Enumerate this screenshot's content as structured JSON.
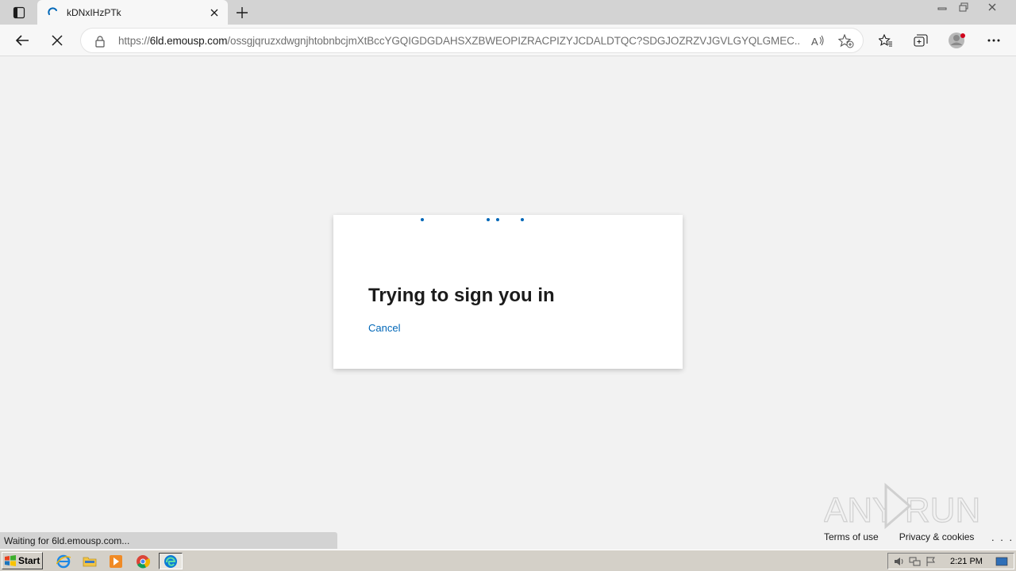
{
  "browser": {
    "tab": {
      "title": "kDNxIHzPTk"
    },
    "address": {
      "prefix": "https://",
      "host": "6ld.emousp.com",
      "path": "/ossgjqruzxdwgnjhtobnbcjmXtBccYGQIGDGDAHSXZBWEOPIZRACPIZYJCDALDTQC?SDGJOZRZVJGVLGYQLGMEC..."
    },
    "status_text": "Waiting for 6ld.emousp.com..."
  },
  "page": {
    "title": "Trying to sign you in",
    "cancel_label": "Cancel",
    "footer": {
      "terms_label": "Terms of use",
      "privacy_label": "Privacy & cookies",
      "more_label": ". . ."
    },
    "accent_color": "#0067b8"
  },
  "watermark": {
    "text": "ANY RUN"
  },
  "taskbar": {
    "start_label": "Start",
    "clock": "2:21 PM",
    "apps": [
      "internet-explorer-icon",
      "folder-icon",
      "media-player-icon",
      "chrome-icon",
      "edge-icon"
    ]
  }
}
